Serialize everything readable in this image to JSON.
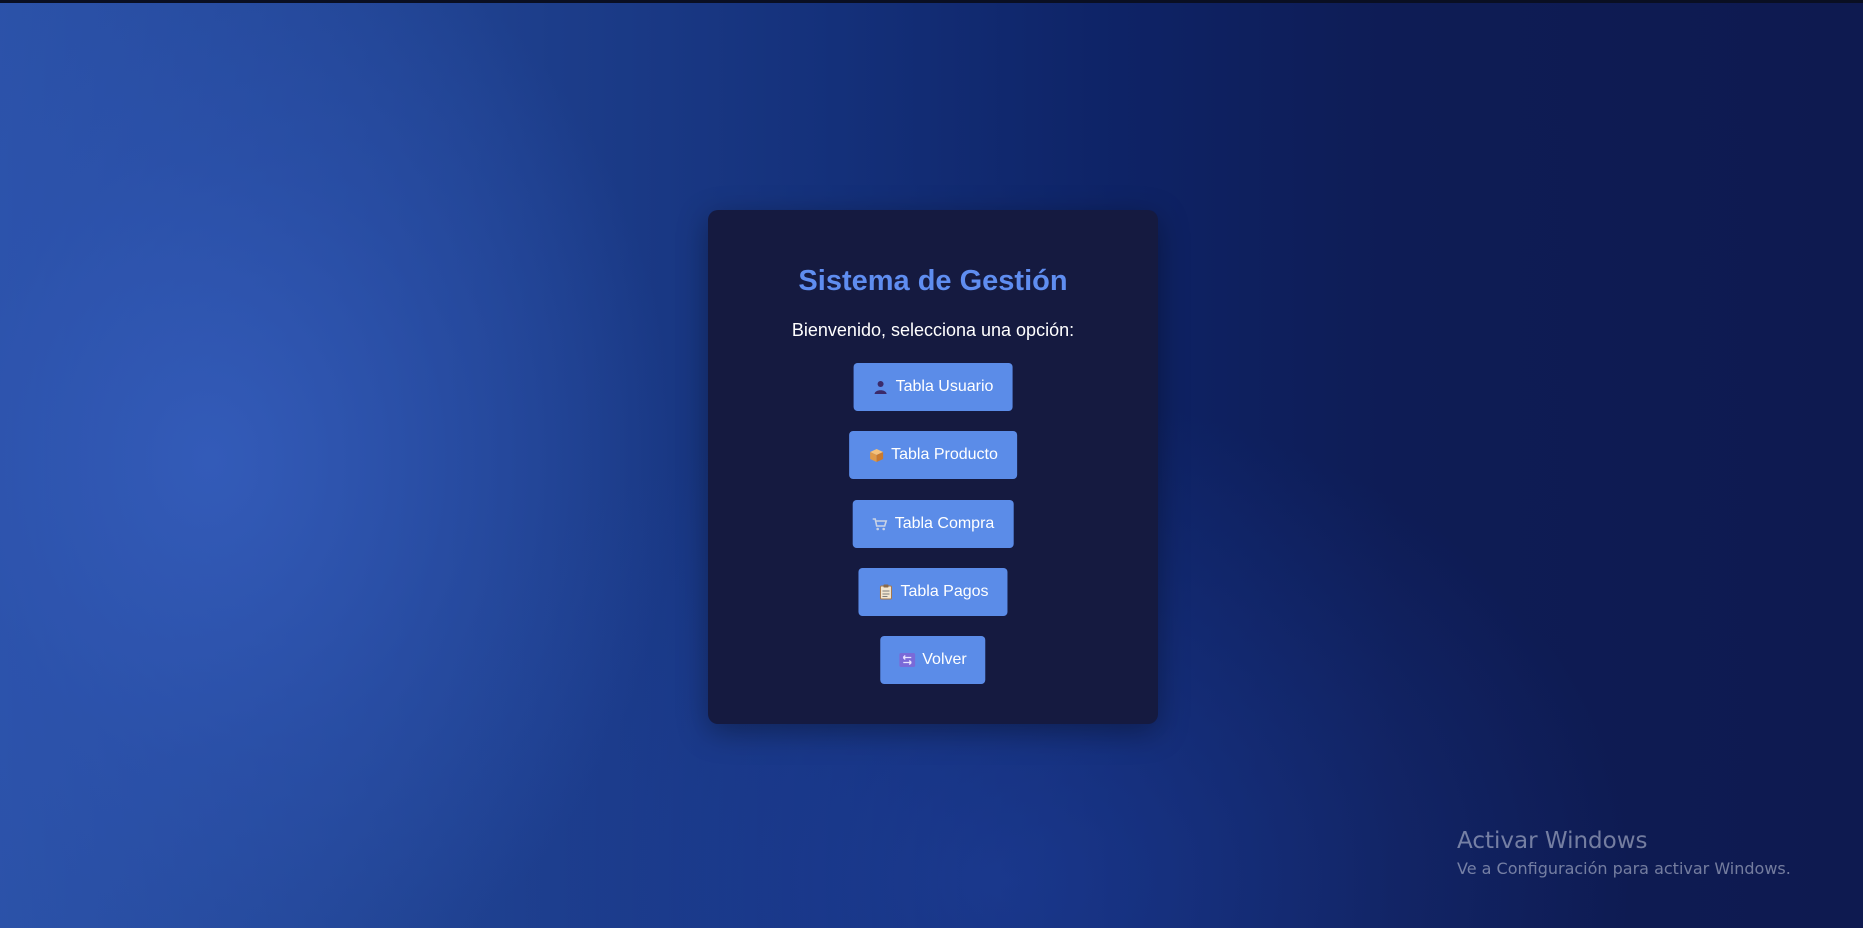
{
  "page": {
    "title": "Sistema de Gestión",
    "subtitle": "Bienvenido, selecciona una opción:"
  },
  "menu": {
    "buttons": [
      {
        "label": "Tabla Usuario",
        "icon": "user-icon"
      },
      {
        "label": "Tabla Producto",
        "icon": "package-icon"
      },
      {
        "label": "Tabla Compra",
        "icon": "shopping-cart-icon"
      },
      {
        "label": "Tabla Pagos",
        "icon": "clipboard-icon"
      },
      {
        "label": "Volver",
        "icon": "back-arrows-icon"
      }
    ]
  },
  "watermark": {
    "title": "Activar Windows",
    "subtitle": "Ve a Configuración para activar Windows."
  },
  "colors": {
    "card_background": "#151a40",
    "title": "#5f8df0",
    "button": "#5b8ce8",
    "button_text": "#ffffff"
  }
}
